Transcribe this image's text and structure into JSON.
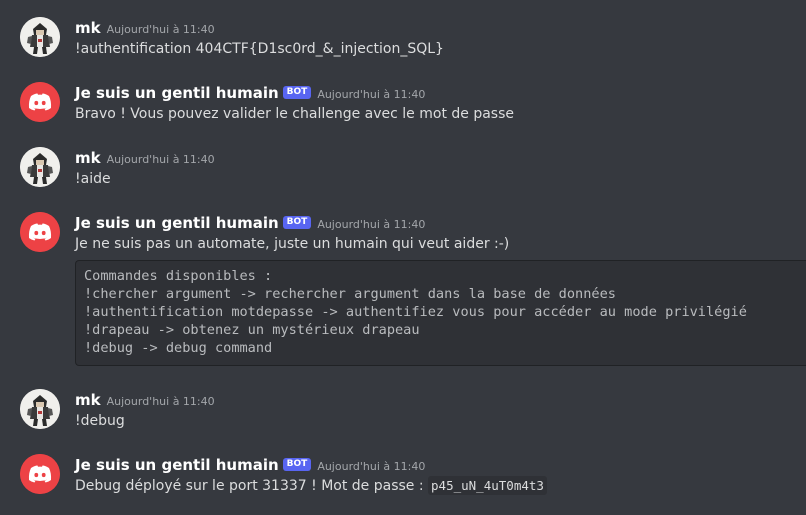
{
  "messages": [
    {
      "author": "mk",
      "timestamp": "Aujourd'hui à 11:40",
      "content": "!authentification 404CTF{D1sc0rd_&_injection_SQL}"
    },
    {
      "author": "Je suis un gentil humain",
      "bot_tag": "BOT",
      "timestamp": "Aujourd'hui à 11:40",
      "content": "Bravo ! Vous pouvez valider le challenge avec le mot de passe"
    },
    {
      "author": "mk",
      "timestamp": "Aujourd'hui à 11:40",
      "content": "!aide"
    },
    {
      "author": "Je suis un gentil humain",
      "bot_tag": "BOT",
      "timestamp": "Aujourd'hui à 11:40",
      "content": "Je ne suis pas un automate, juste un humain qui veut aider :-)",
      "code_lines": [
        "Commandes disponibles :",
        "!chercher argument -> rechercher argument dans la base de données",
        "!authentification motdepasse -> authentifiez vous pour accéder au mode privilégié",
        "!drapeau -> obtenez un mystérieux drapeau",
        "!debug -> debug command"
      ]
    },
    {
      "author": "mk",
      "timestamp": "Aujourd'hui à 11:40",
      "content": "!debug"
    },
    {
      "author": "Je suis un gentil humain",
      "bot_tag": "BOT",
      "timestamp": "Aujourd'hui à 11:40",
      "content": "Debug déployé sur le port 31337 ! Mot de passe : ",
      "inline_code": "p45_uN_4uT0m4t3"
    }
  ],
  "colors": {
    "background": "#36393f",
    "bot_avatar": "#ed4245",
    "bot_tag": "#5865f2",
    "code_background": "#2f3136"
  },
  "icons": {
    "user_avatar": "assassin-avatar-icon",
    "bot_avatar": "discord-logo-icon"
  }
}
